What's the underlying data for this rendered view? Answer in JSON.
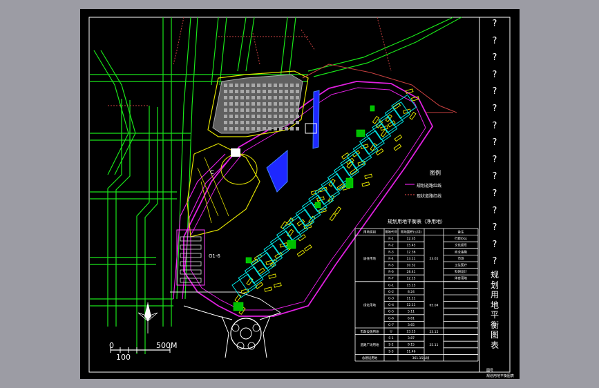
{
  "drawing": {
    "title_vertical": "规划用地平衡图表",
    "question_marks": [
      "?",
      "?",
      "?",
      "?",
      "?",
      "?",
      "?",
      "?",
      "?",
      "?",
      "?",
      "?",
      "?",
      "?",
      "?"
    ],
    "scale_bar": {
      "start": "0",
      "mid": "100",
      "end": "500M"
    },
    "legend_title": "图例",
    "legend_items": [
      "规划道路红线",
      "现状道路红线"
    ],
    "zone_labels": {
      "c_zone": "C",
      "gi": "G1-6"
    },
    "table": {
      "title": "规划用地平衡表（净用地）",
      "headers": [
        "用地类别",
        "用地代号",
        "用地面积(公顷)",
        "",
        "备注"
      ],
      "groups": [
        {
          "name": "居住用地",
          "total": "23.65",
          "rows": [
            [
              "R-1",
              "12.35",
              "行政办公"
            ],
            [
              "R-2",
              "15.45",
              "文化娱乐"
            ],
            [
              "R-3",
              "12.36",
              "商业金融"
            ],
            [
              "R-4",
              "13.11",
              "市场"
            ],
            [
              "R-5",
              "10.32",
              "卫生医疗"
            ],
            [
              "R-6",
              "28.41",
              "科研设计"
            ],
            [
              "R-7",
              "12.15",
              "体育用地"
            ]
          ]
        },
        {
          "name": "绿化用地",
          "total": "65.04",
          "rows": [
            [
              "G-1",
              "15.15",
              ""
            ],
            [
              "G-2",
              "8.24",
              ""
            ],
            [
              "G-3",
              "11.11",
              ""
            ],
            [
              "G-4",
              "12.11",
              ""
            ],
            [
              "G-5",
              "5.11",
              ""
            ],
            [
              "G-6",
              "6.61",
              ""
            ],
            [
              "G-7",
              "3.65",
              ""
            ]
          ]
        },
        {
          "name": "市政设施用地",
          "total": "23.15",
          "rows": [
            [
              "U",
              "23.15",
              ""
            ]
          ]
        },
        {
          "name": "道路广场用地",
          "total": "25.11",
          "rows": [
            [
              "S-1",
              "3.87",
              ""
            ],
            [
              "S-2",
              "9.15",
              ""
            ],
            [
              "S-3",
              "11.46",
              ""
            ]
          ]
        }
      ],
      "footer": [
        "总建设用地",
        "361.15公顷"
      ]
    },
    "corner_note": [
      "图号",
      "规划用地平衡图表"
    ]
  }
}
